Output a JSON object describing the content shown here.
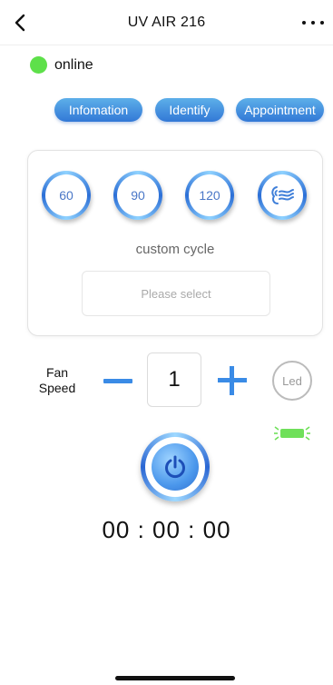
{
  "header": {
    "title": "UV AIR 216",
    "back_icon": "chevron-left-icon",
    "more_icon": "more-dots-icon"
  },
  "status": {
    "label": "online",
    "color": "#5ee04a"
  },
  "tabs": [
    {
      "label": "Infomation"
    },
    {
      "label": "Identify"
    },
    {
      "label": "Appointment"
    }
  ],
  "cycles": {
    "options": [
      "60",
      "90",
      "120"
    ],
    "fan_icon": "fan-wind-icon",
    "custom_label": "custom cycle",
    "select_placeholder": "Please select"
  },
  "fan_speed": {
    "label_line1": "Fan",
    "label_line2": "Speed",
    "value": "1"
  },
  "led": {
    "label": "Led",
    "indicator_color": "#6fe05a"
  },
  "power": {
    "icon": "power-icon"
  },
  "timer": {
    "hours": "00",
    "minutes": "00",
    "seconds": "00"
  },
  "colors": {
    "accent": "#3a8be6",
    "online": "#5ee04a"
  }
}
